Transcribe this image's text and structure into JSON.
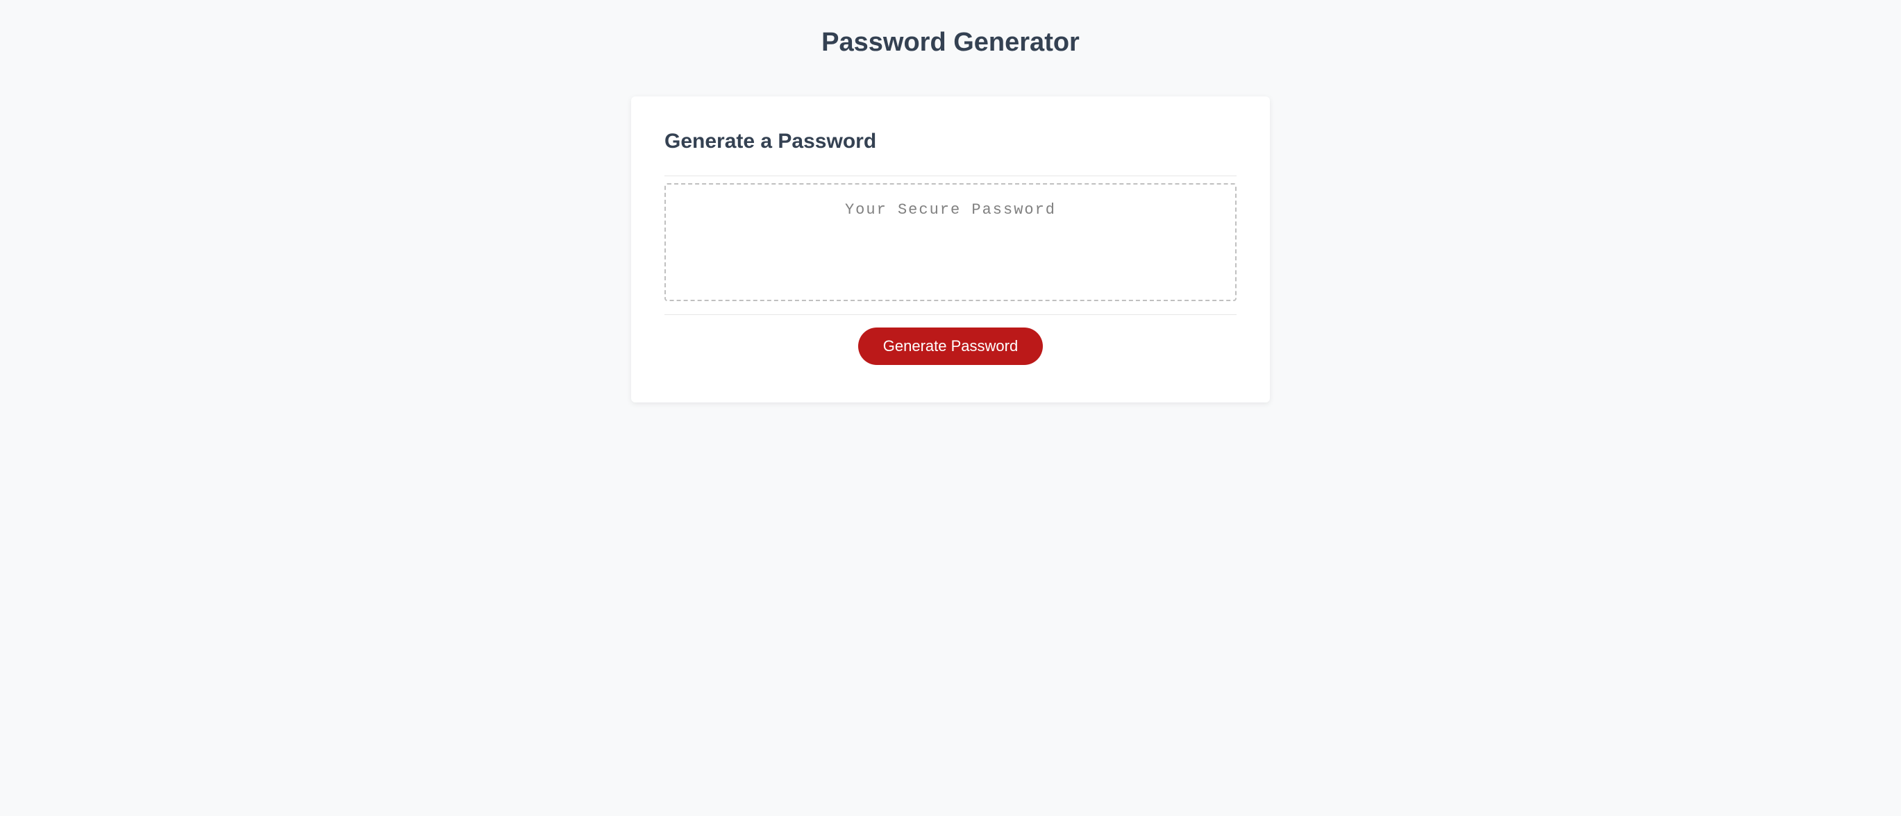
{
  "page": {
    "title": "Password Generator"
  },
  "card": {
    "title": "Generate a Password",
    "password_placeholder": "Your Secure Password",
    "password_value": "",
    "button_label": "Generate Password"
  },
  "colors": {
    "accent": "#bb1919",
    "text_dark": "#344152",
    "bg": "#f8f9fa"
  }
}
